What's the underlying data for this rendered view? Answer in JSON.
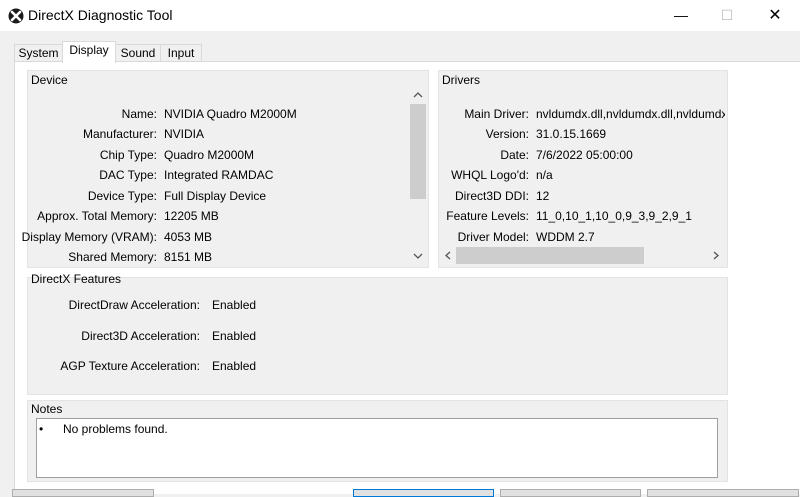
{
  "window": {
    "title": "DirectX Diagnostic Tool",
    "minimize": "—",
    "maximize": "☐",
    "close": "✕"
  },
  "tabs": [
    {
      "label": "System"
    },
    {
      "label": "Display"
    },
    {
      "label": "Sound"
    },
    {
      "label": "Input"
    }
  ],
  "device": {
    "title": "Device",
    "rows": [
      {
        "label": "Name:",
        "value": "NVIDIA Quadro M2000M"
      },
      {
        "label": "Manufacturer:",
        "value": "NVIDIA"
      },
      {
        "label": "Chip Type:",
        "value": "Quadro M2000M"
      },
      {
        "label": "DAC Type:",
        "value": "Integrated RAMDAC"
      },
      {
        "label": "Device Type:",
        "value": "Full Display Device"
      },
      {
        "label": "Approx. Total Memory:",
        "value": "12205 MB"
      },
      {
        "label": "Display Memory (VRAM):",
        "value": "4053 MB"
      },
      {
        "label": "Shared Memory:",
        "value": "8151 MB"
      }
    ]
  },
  "drivers": {
    "title": "Drivers",
    "rows": [
      {
        "label": "Main Driver:",
        "value": "nvldumdx.dll,nvldumdx.dll,nvldumdx.dl"
      },
      {
        "label": "Version:",
        "value": "31.0.15.1669"
      },
      {
        "label": "Date:",
        "value": "7/6/2022 05:00:00"
      },
      {
        "label": "WHQL Logo'd:",
        "value": "n/a"
      },
      {
        "label": "Direct3D DDI:",
        "value": "12"
      },
      {
        "label": "Feature Levels:",
        "value": "11_0,10_1,10_0,9_3,9_2,9_1"
      },
      {
        "label": "Driver Model:",
        "value": "WDDM 2.7"
      }
    ]
  },
  "features": {
    "title": "DirectX Features",
    "rows": [
      {
        "label": "DirectDraw Acceleration:",
        "value": "Enabled"
      },
      {
        "label": "Direct3D Acceleration:",
        "value": "Enabled"
      },
      {
        "label": "AGP Texture Acceleration:",
        "value": "Enabled"
      }
    ]
  },
  "notes": {
    "title": "Notes",
    "bullet": "•",
    "text": "No problems found."
  },
  "icons": {
    "app": "directx-icon",
    "up": "chevron-up-icon",
    "down": "chevron-down-icon",
    "left": "chevron-left-icon",
    "right": "chevron-right-icon"
  }
}
